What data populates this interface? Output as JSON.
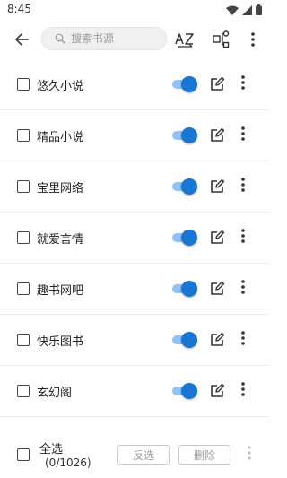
{
  "status_bar": {
    "time": "8:45"
  },
  "toolbar": {
    "search_placeholder": "搜索书源"
  },
  "sources": [
    {
      "name": "悠久小说",
      "enabled": true,
      "checked": false
    },
    {
      "name": "精品小说",
      "enabled": true,
      "checked": false
    },
    {
      "name": "宝里网络",
      "enabled": true,
      "checked": false
    },
    {
      "name": "就爱言情",
      "enabled": true,
      "checked": false
    },
    {
      "name": "趣书网吧",
      "enabled": true,
      "checked": false
    },
    {
      "name": "快乐图书",
      "enabled": true,
      "checked": false
    },
    {
      "name": "玄幻阁",
      "enabled": true,
      "checked": false
    }
  ],
  "bottom_bar": {
    "select_all_label": "全选",
    "count_label": "(0/1026)",
    "invert_label": "反选",
    "delete_label": "删除"
  },
  "colors": {
    "accent": "#1976d2",
    "track": "#90c2f7"
  },
  "icons": [
    "wifi-icon",
    "signal-icon",
    "battery-icon",
    "back-arrow-icon",
    "search-icon",
    "sort-az-icon",
    "group-icon",
    "more-vert-icon",
    "edit-icon"
  ]
}
